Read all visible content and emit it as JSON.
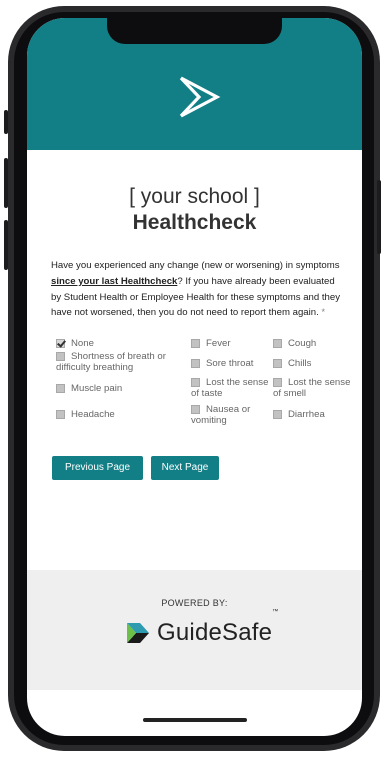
{
  "colors": {
    "accent": "#127f86",
    "footer_bg": "#efefef"
  },
  "title": {
    "line1": "[ your school ]",
    "line2": "Healthcheck"
  },
  "question": {
    "prefix": "Have you experienced any change (new or worsening) in symptoms ",
    "emphasis": "since your last Healthcheck",
    "suffix": "? If you have already been evaluated by Student Health or Employee Health for these symptoms and they have not worsened, then you do not need to report them again.",
    "required_mark": "*"
  },
  "symptoms": [
    {
      "label": "None",
      "checked": true
    },
    {
      "label": "Fever",
      "checked": false
    },
    {
      "label": "Cough",
      "checked": false
    },
    {
      "label": "Shortness of breath or difficulty breathing",
      "checked": false
    },
    {
      "label": "Sore throat",
      "checked": false
    },
    {
      "label": "Chills",
      "checked": false
    },
    {
      "label": "Muscle pain",
      "checked": false
    },
    {
      "label": "Lost the sense of taste",
      "checked": false
    },
    {
      "label": "Lost the sense of smell",
      "checked": false
    },
    {
      "label": "Headache",
      "checked": false
    },
    {
      "label": "Nausea or vomiting",
      "checked": false
    },
    {
      "label": "Diarrhea",
      "checked": false
    }
  ],
  "buttons": {
    "previous": "Previous Page",
    "next": "Next Page"
  },
  "footer": {
    "powered_by": "POWERED BY:",
    "brand": "GuideSafe",
    "trademark": "™"
  },
  "icons": {
    "header_logo": "chevron-logo-icon",
    "brand_logo": "guidesafe-chevron-icon"
  }
}
